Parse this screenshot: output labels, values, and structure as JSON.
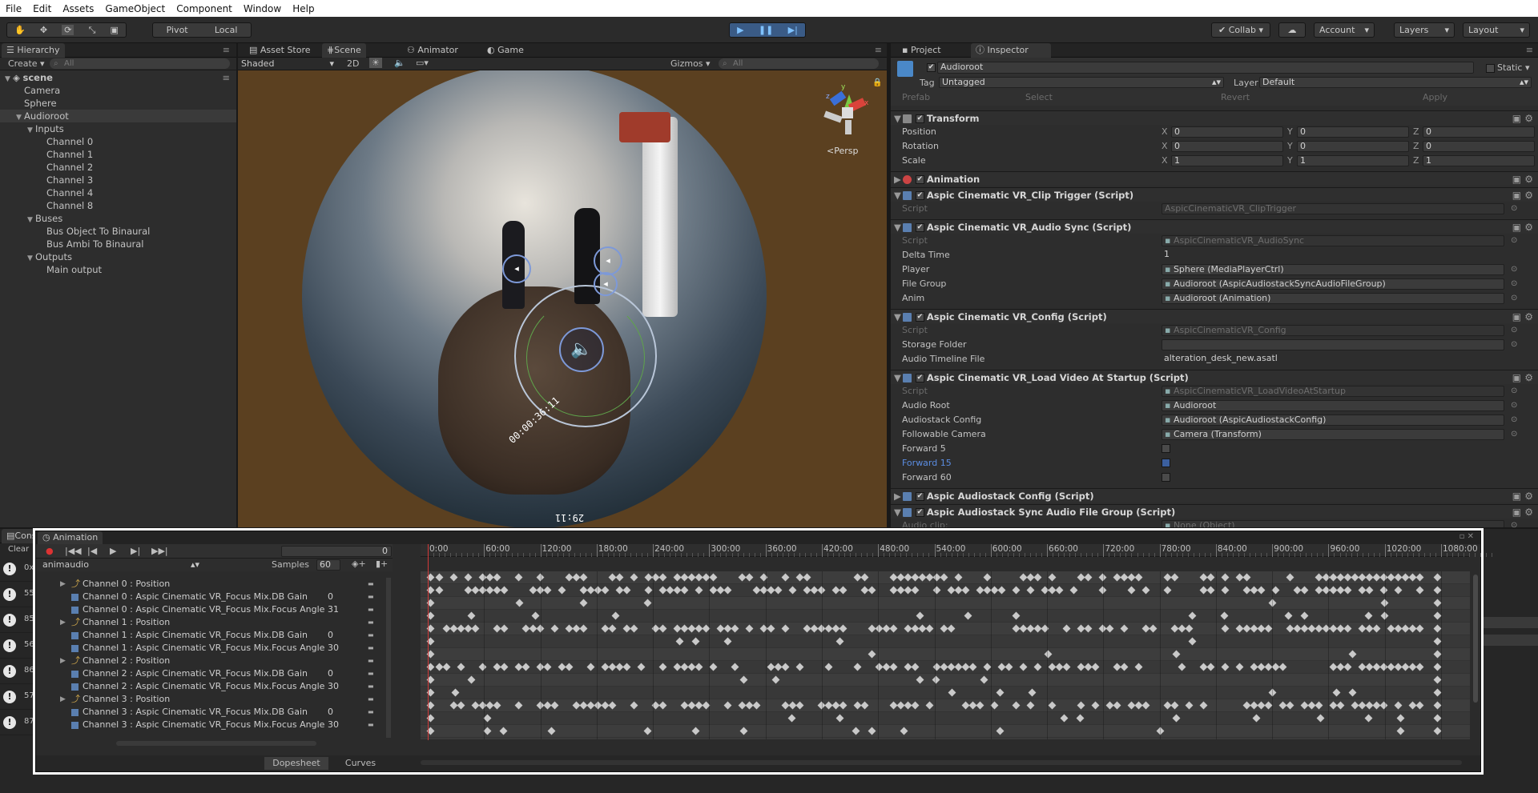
{
  "menubar": {
    "items": [
      "File",
      "Edit",
      "Assets",
      "GameObject",
      "Component",
      "Window",
      "Help"
    ]
  },
  "toolbar": {
    "pivot": "Pivot",
    "local": "Local",
    "collab": "Collab",
    "account": "Account",
    "layers": "Layers",
    "layout": "Layout"
  },
  "hierarchy": {
    "tab": "Hierarchy",
    "create": "Create",
    "search": "All",
    "rows": [
      {
        "label": "scene",
        "indent": 0,
        "arrow": "▼",
        "bold": true
      },
      {
        "label": "Camera",
        "indent": 1,
        "arrow": ""
      },
      {
        "label": "Sphere",
        "indent": 1,
        "arrow": ""
      },
      {
        "label": "Audioroot",
        "indent": 1,
        "arrow": "▼",
        "selected": true
      },
      {
        "label": "Inputs",
        "indent": 2,
        "arrow": "▼"
      },
      {
        "label": "Channel 0",
        "indent": 3,
        "arrow": ""
      },
      {
        "label": "Channel 1",
        "indent": 3,
        "arrow": ""
      },
      {
        "label": "Channel 2",
        "indent": 3,
        "arrow": ""
      },
      {
        "label": "Channel 3",
        "indent": 3,
        "arrow": ""
      },
      {
        "label": "Channel 4",
        "indent": 3,
        "arrow": ""
      },
      {
        "label": "Channel 8",
        "indent": 3,
        "arrow": ""
      },
      {
        "label": "Buses",
        "indent": 2,
        "arrow": "▼"
      },
      {
        "label": "Bus Object To Binaural",
        "indent": 3,
        "arrow": ""
      },
      {
        "label": "Bus Ambi To Binaural",
        "indent": 3,
        "arrow": ""
      },
      {
        "label": "Outputs",
        "indent": 2,
        "arrow": "▼"
      },
      {
        "label": "Main output",
        "indent": 3,
        "arrow": ""
      }
    ]
  },
  "center_tabs": [
    "Asset Store",
    "Scene",
    "Animator",
    "Game"
  ],
  "scene": {
    "shading": "Shaded",
    "mode2d": "2D",
    "gizmos": "Gizmos",
    "search": "All",
    "persp": "Persp",
    "timecode1": "00:00:36:11",
    "timecode2": "29:11"
  },
  "inspector": {
    "tabs": [
      "Project",
      "Inspector"
    ],
    "object_name": "Audioroot",
    "static": "Static",
    "tag_label": "Tag",
    "tag_value": "Untagged",
    "layer_label": "Layer",
    "layer_value": "Default",
    "prefab": "Prefab",
    "select": "Select",
    "revert": "Revert",
    "apply": "Apply",
    "transform": {
      "title": "Transform",
      "rows": [
        {
          "label": "Position",
          "x": "0",
          "y": "0",
          "z": "0"
        },
        {
          "label": "Rotation",
          "x": "0",
          "y": "0",
          "z": "0"
        },
        {
          "label": "Scale",
          "x": "1",
          "y": "1",
          "z": "1"
        }
      ]
    },
    "animation_title": "Animation",
    "clip_trigger": {
      "title": "Aspic Cinematic VR_Clip Trigger (Script)",
      "script_label": "Script",
      "script_value": "AspicCinematicVR_ClipTrigger"
    },
    "audio_sync": {
      "title": "Aspic Cinematic VR_Audio Sync (Script)",
      "rows": [
        {
          "label": "Script",
          "value": "AspicCinematicVR_AudioSync",
          "dim": true
        },
        {
          "label": "Delta Time",
          "value": "1",
          "plain": true
        },
        {
          "label": "Player",
          "value": "Sphere (MediaPlayerCtrl)"
        },
        {
          "label": "File Group",
          "value": "Audioroot (AspicAudiostackSyncAudioFileGroup)"
        },
        {
          "label": "Anim",
          "value": "Audioroot (Animation)"
        }
      ]
    },
    "config": {
      "title": "Aspic Cinematic VR_Config (Script)",
      "rows": [
        {
          "label": "Script",
          "value": "AspicCinematicVR_Config",
          "dim": true
        },
        {
          "label": "Storage Folder",
          "value": ""
        },
        {
          "label": "Audio Timeline File",
          "value": "alteration_desk_new.asatl",
          "plain": true
        }
      ]
    },
    "load_video": {
      "title": "Aspic Cinematic VR_Load Video At Startup (Script)",
      "rows": [
        {
          "label": "Script",
          "value": "AspicCinematicVR_LoadVideoAtStartup",
          "dim": true
        },
        {
          "label": "Audio Root",
          "value": "Audioroot"
        },
        {
          "label": "Audiostack Config",
          "value": "Audioroot (AspicAudiostackConfig)"
        },
        {
          "label": "Followable Camera",
          "value": "Camera (Transform)"
        }
      ]
    },
    "forward": [
      {
        "label": "Forward 5",
        "blue": false
      },
      {
        "label": "Forward 15",
        "blue": true
      },
      {
        "label": "Forward 60",
        "blue": false
      }
    ],
    "audiostack_config_title": "Aspic Audiostack Config (Script)",
    "sync_group_title": "Aspic Audiostack Sync Audio File Group (Script)",
    "audio_clip_label": "Audio clip:",
    "audio_clip_value": "None (Object)"
  },
  "console": {
    "tab": "Cons",
    "clear": "Clear",
    "counts": [
      "0x",
      "55",
      "85",
      "56",
      "86",
      "57",
      "87"
    ]
  },
  "animation": {
    "title": "Animation",
    "frame": "0",
    "clip": "animaudio",
    "samples_label": "Samples",
    "samples": "60",
    "ruler": [
      "0:00",
      "60:00",
      "120:00",
      "180:00",
      "240:00",
      "300:00",
      "360:00",
      "420:00",
      "480:00",
      "540:00",
      "600:00",
      "660:00",
      "720:00",
      "780:00",
      "840:00",
      "900:00",
      "960:00",
      "1020:00",
      "1080:00"
    ],
    "rows": [
      {
        "label": "Channel 0 : Position",
        "value": "",
        "pos": true
      },
      {
        "label": "Channel 0 : Aspic Cinematic VR_Focus Mix.DB Gain",
        "value": "0"
      },
      {
        "label": "Channel 0 : Aspic Cinematic VR_Focus Mix.Focus Angle",
        "value": "31"
      },
      {
        "label": "Channel 1 : Position",
        "value": "",
        "pos": true
      },
      {
        "label": "Channel 1 : Aspic Cinematic VR_Focus Mix.DB Gain",
        "value": "0"
      },
      {
        "label": "Channel 1 : Aspic Cinematic VR_Focus Mix.Focus Angle",
        "value": "30"
      },
      {
        "label": "Channel 2 : Position",
        "value": "",
        "pos": true
      },
      {
        "label": "Channel 2 : Aspic Cinematic VR_Focus Mix.DB Gain",
        "value": "0"
      },
      {
        "label": "Channel 2 : Aspic Cinematic VR_Focus Mix.Focus Angle",
        "value": "30"
      },
      {
        "label": "Channel 3 : Position",
        "value": "",
        "pos": true
      },
      {
        "label": "Channel 3 : Aspic Cinematic VR_Focus Mix.DB Gain",
        "value": "0"
      },
      {
        "label": "Channel 3 : Aspic Cinematic VR_Focus Mix.Focus Angle",
        "value": "30"
      }
    ],
    "dopesheet": "Dopesheet",
    "curves": "Curves"
  }
}
